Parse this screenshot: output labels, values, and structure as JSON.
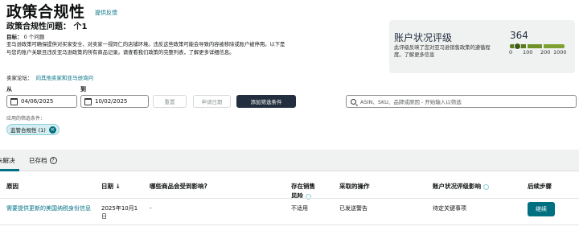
{
  "header": {
    "title": "政策合规性",
    "feedback_link": "提供反馈",
    "issues_label": "政策合规性问题：",
    "issues_count": "个1",
    "goal_label": "目标：",
    "goal_value": "0 个问题",
    "description": "亚马逊政策可确保提供对买家安全、对卖家一视同仁的店铺环境。违反这些政策可能会导致内容被移除或账户被停用。以下是与您的账户关联且违反亚马逊政策的所有商品记录。请查看我们政策的完整列表，了解更多详细信息。",
    "forum_label": "卖家论坛：",
    "forum_link": "向其他卖家和亚马逊询问"
  },
  "health_card": {
    "title": "账户状况评级",
    "description": "此评级反映了您对亚马逊销售政策的遵循程度。了解更多信息",
    "score": "364",
    "ticks": [
      "0",
      "100",
      "200",
      "1000"
    ],
    "score_value": 364
  },
  "filters": {
    "from_label": "从",
    "from_date": "04/06/2025",
    "to_label": "到",
    "to_date": "10/02/2025",
    "reset_button": "重置",
    "apply_date_button": "申请日期",
    "add_filter_button": "添加筛选条件",
    "search_placeholder": "ASIN、SKU、品牌或原因 - 开始输入以筛选",
    "applied_label": "应用的筛选条件：",
    "chip_label": "监管合规性 (1)"
  },
  "tabs": [
    {
      "label": "未解决"
    },
    {
      "label": "已存档"
    }
  ],
  "table": {
    "headers": {
      "reason": "原因",
      "date": "日期 ↓",
      "affected": "哪些商品会受到影响?",
      "at_risk_1": "存在销售",
      "at_risk_2": "风险",
      "action": "采取的操作",
      "impact": "账户状况评级影响",
      "next": "后续步骤"
    },
    "rows": [
      {
        "reason": "需要提供更新的美国纳税身份信息",
        "date_1": "2025年10月1",
        "date_2": "日",
        "affected": "-",
        "at_risk": "不适用",
        "action": "已发送警告",
        "impact": "待定关键事项",
        "next_button": "继续"
      }
    ]
  },
  "colors": {
    "link": "#007185",
    "dark_button": "#232f3e",
    "teal_button": "#006f7f",
    "card_bg": "#f0f2f2"
  }
}
